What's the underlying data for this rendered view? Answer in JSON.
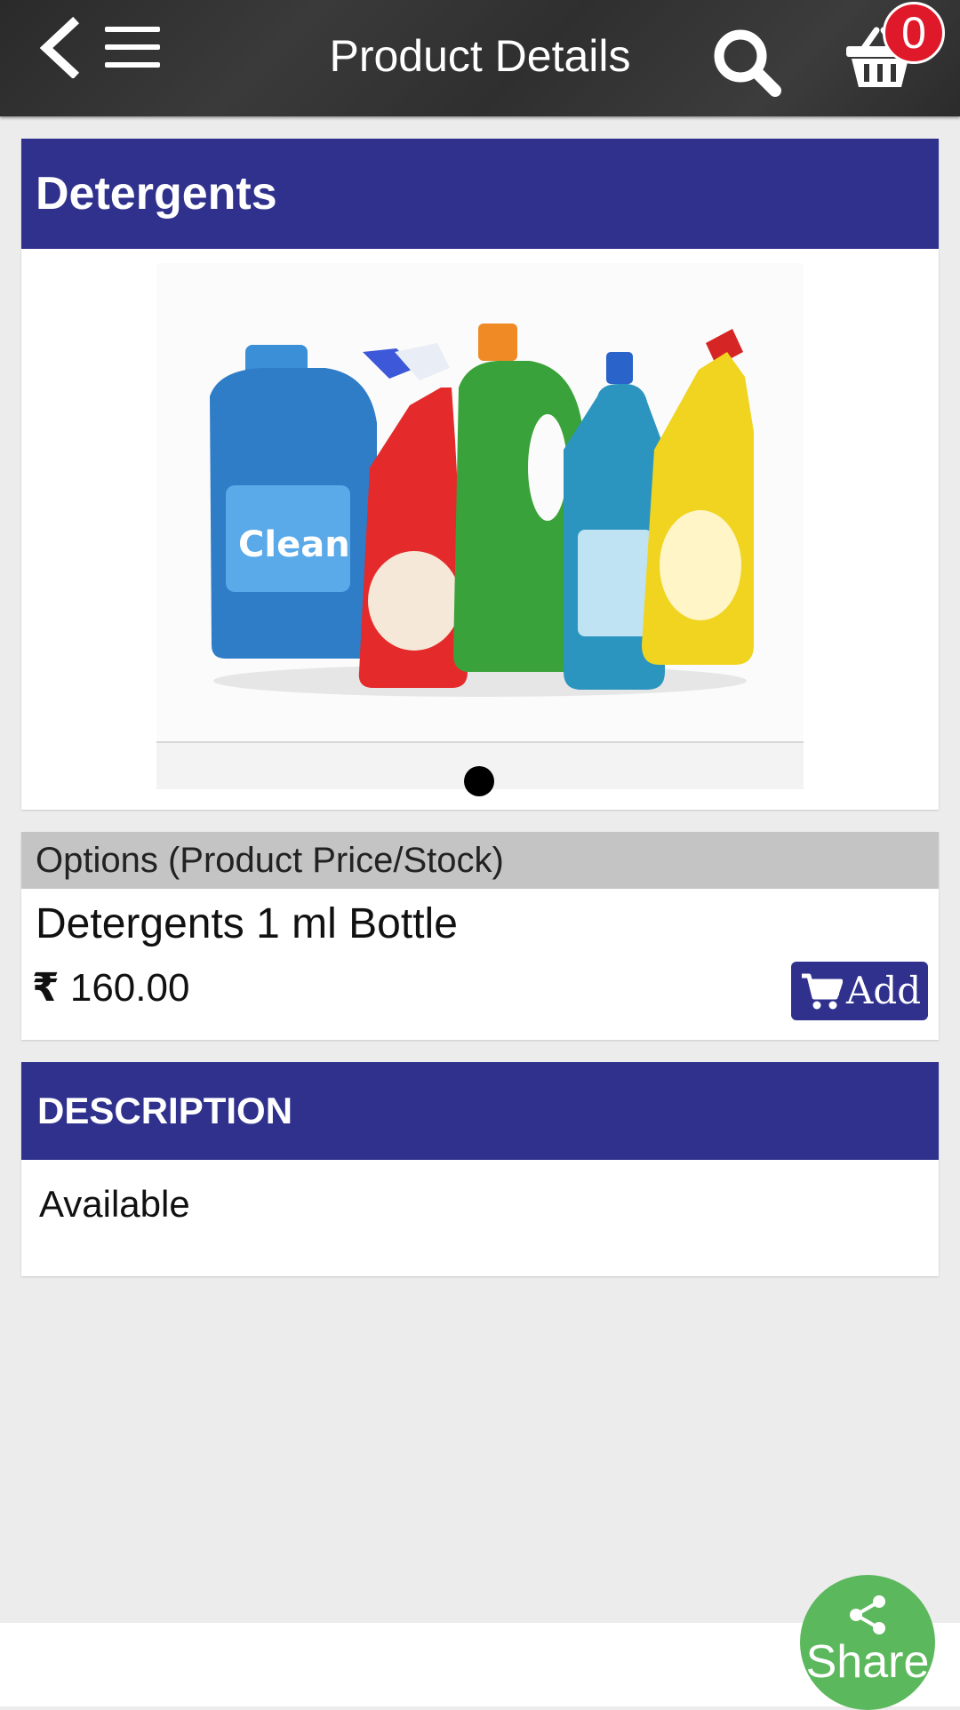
{
  "header": {
    "title": "Product Details",
    "cart_count": "0"
  },
  "product": {
    "category_title": "Detergents",
    "image_alt": "Detergents bottles",
    "options_header": "Options (Product Price/Stock)",
    "option_name": "Detergents 1 ml Bottle",
    "currency_symbol": "₹",
    "price": "160.00",
    "add_label": "Add"
  },
  "description": {
    "header": "DESCRIPTION",
    "text": "Available"
  },
  "share": {
    "label": "Share"
  },
  "colors": {
    "header_bg": "#2f2f2f",
    "accent": "#2f318d",
    "badge": "#e0192a",
    "share": "#5cb85c",
    "options_bar": "#c4c4c4",
    "page_bg": "#ececec"
  }
}
